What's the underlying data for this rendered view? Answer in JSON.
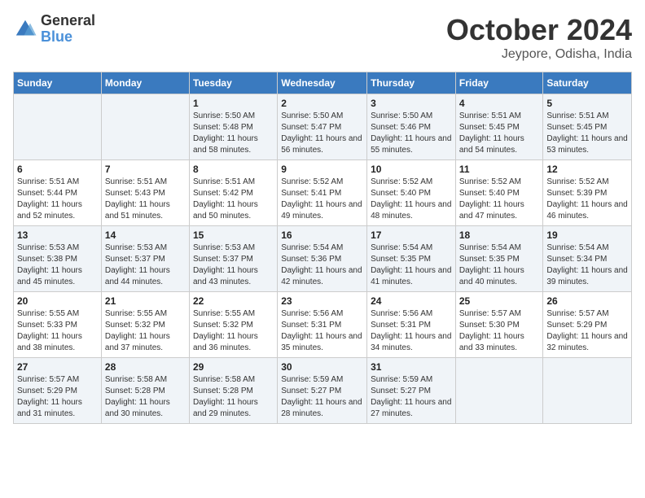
{
  "logo": {
    "general": "General",
    "blue": "Blue"
  },
  "title": "October 2024",
  "location": "Jeypore, Odisha, India",
  "weekdays": [
    "Sunday",
    "Monday",
    "Tuesday",
    "Wednesday",
    "Thursday",
    "Friday",
    "Saturday"
  ],
  "weeks": [
    [
      {
        "day": "",
        "sunrise": "",
        "sunset": "",
        "daylight": ""
      },
      {
        "day": "",
        "sunrise": "",
        "sunset": "",
        "daylight": ""
      },
      {
        "day": "1",
        "sunrise": "Sunrise: 5:50 AM",
        "sunset": "Sunset: 5:48 PM",
        "daylight": "Daylight: 11 hours and 58 minutes."
      },
      {
        "day": "2",
        "sunrise": "Sunrise: 5:50 AM",
        "sunset": "Sunset: 5:47 PM",
        "daylight": "Daylight: 11 hours and 56 minutes."
      },
      {
        "day": "3",
        "sunrise": "Sunrise: 5:50 AM",
        "sunset": "Sunset: 5:46 PM",
        "daylight": "Daylight: 11 hours and 55 minutes."
      },
      {
        "day": "4",
        "sunrise": "Sunrise: 5:51 AM",
        "sunset": "Sunset: 5:45 PM",
        "daylight": "Daylight: 11 hours and 54 minutes."
      },
      {
        "day": "5",
        "sunrise": "Sunrise: 5:51 AM",
        "sunset": "Sunset: 5:45 PM",
        "daylight": "Daylight: 11 hours and 53 minutes."
      }
    ],
    [
      {
        "day": "6",
        "sunrise": "Sunrise: 5:51 AM",
        "sunset": "Sunset: 5:44 PM",
        "daylight": "Daylight: 11 hours and 52 minutes."
      },
      {
        "day": "7",
        "sunrise": "Sunrise: 5:51 AM",
        "sunset": "Sunset: 5:43 PM",
        "daylight": "Daylight: 11 hours and 51 minutes."
      },
      {
        "day": "8",
        "sunrise": "Sunrise: 5:51 AM",
        "sunset": "Sunset: 5:42 PM",
        "daylight": "Daylight: 11 hours and 50 minutes."
      },
      {
        "day": "9",
        "sunrise": "Sunrise: 5:52 AM",
        "sunset": "Sunset: 5:41 PM",
        "daylight": "Daylight: 11 hours and 49 minutes."
      },
      {
        "day": "10",
        "sunrise": "Sunrise: 5:52 AM",
        "sunset": "Sunset: 5:40 PM",
        "daylight": "Daylight: 11 hours and 48 minutes."
      },
      {
        "day": "11",
        "sunrise": "Sunrise: 5:52 AM",
        "sunset": "Sunset: 5:40 PM",
        "daylight": "Daylight: 11 hours and 47 minutes."
      },
      {
        "day": "12",
        "sunrise": "Sunrise: 5:52 AM",
        "sunset": "Sunset: 5:39 PM",
        "daylight": "Daylight: 11 hours and 46 minutes."
      }
    ],
    [
      {
        "day": "13",
        "sunrise": "Sunrise: 5:53 AM",
        "sunset": "Sunset: 5:38 PM",
        "daylight": "Daylight: 11 hours and 45 minutes."
      },
      {
        "day": "14",
        "sunrise": "Sunrise: 5:53 AM",
        "sunset": "Sunset: 5:37 PM",
        "daylight": "Daylight: 11 hours and 44 minutes."
      },
      {
        "day": "15",
        "sunrise": "Sunrise: 5:53 AM",
        "sunset": "Sunset: 5:37 PM",
        "daylight": "Daylight: 11 hours and 43 minutes."
      },
      {
        "day": "16",
        "sunrise": "Sunrise: 5:54 AM",
        "sunset": "Sunset: 5:36 PM",
        "daylight": "Daylight: 11 hours and 42 minutes."
      },
      {
        "day": "17",
        "sunrise": "Sunrise: 5:54 AM",
        "sunset": "Sunset: 5:35 PM",
        "daylight": "Daylight: 11 hours and 41 minutes."
      },
      {
        "day": "18",
        "sunrise": "Sunrise: 5:54 AM",
        "sunset": "Sunset: 5:35 PM",
        "daylight": "Daylight: 11 hours and 40 minutes."
      },
      {
        "day": "19",
        "sunrise": "Sunrise: 5:54 AM",
        "sunset": "Sunset: 5:34 PM",
        "daylight": "Daylight: 11 hours and 39 minutes."
      }
    ],
    [
      {
        "day": "20",
        "sunrise": "Sunrise: 5:55 AM",
        "sunset": "Sunset: 5:33 PM",
        "daylight": "Daylight: 11 hours and 38 minutes."
      },
      {
        "day": "21",
        "sunrise": "Sunrise: 5:55 AM",
        "sunset": "Sunset: 5:32 PM",
        "daylight": "Daylight: 11 hours and 37 minutes."
      },
      {
        "day": "22",
        "sunrise": "Sunrise: 5:55 AM",
        "sunset": "Sunset: 5:32 PM",
        "daylight": "Daylight: 11 hours and 36 minutes."
      },
      {
        "day": "23",
        "sunrise": "Sunrise: 5:56 AM",
        "sunset": "Sunset: 5:31 PM",
        "daylight": "Daylight: 11 hours and 35 minutes."
      },
      {
        "day": "24",
        "sunrise": "Sunrise: 5:56 AM",
        "sunset": "Sunset: 5:31 PM",
        "daylight": "Daylight: 11 hours and 34 minutes."
      },
      {
        "day": "25",
        "sunrise": "Sunrise: 5:57 AM",
        "sunset": "Sunset: 5:30 PM",
        "daylight": "Daylight: 11 hours and 33 minutes."
      },
      {
        "day": "26",
        "sunrise": "Sunrise: 5:57 AM",
        "sunset": "Sunset: 5:29 PM",
        "daylight": "Daylight: 11 hours and 32 minutes."
      }
    ],
    [
      {
        "day": "27",
        "sunrise": "Sunrise: 5:57 AM",
        "sunset": "Sunset: 5:29 PM",
        "daylight": "Daylight: 11 hours and 31 minutes."
      },
      {
        "day": "28",
        "sunrise": "Sunrise: 5:58 AM",
        "sunset": "Sunset: 5:28 PM",
        "daylight": "Daylight: 11 hours and 30 minutes."
      },
      {
        "day": "29",
        "sunrise": "Sunrise: 5:58 AM",
        "sunset": "Sunset: 5:28 PM",
        "daylight": "Daylight: 11 hours and 29 minutes."
      },
      {
        "day": "30",
        "sunrise": "Sunrise: 5:59 AM",
        "sunset": "Sunset: 5:27 PM",
        "daylight": "Daylight: 11 hours and 28 minutes."
      },
      {
        "day": "31",
        "sunrise": "Sunrise: 5:59 AM",
        "sunset": "Sunset: 5:27 PM",
        "daylight": "Daylight: 11 hours and 27 minutes."
      },
      {
        "day": "",
        "sunrise": "",
        "sunset": "",
        "daylight": ""
      },
      {
        "day": "",
        "sunrise": "",
        "sunset": "",
        "daylight": ""
      }
    ]
  ]
}
